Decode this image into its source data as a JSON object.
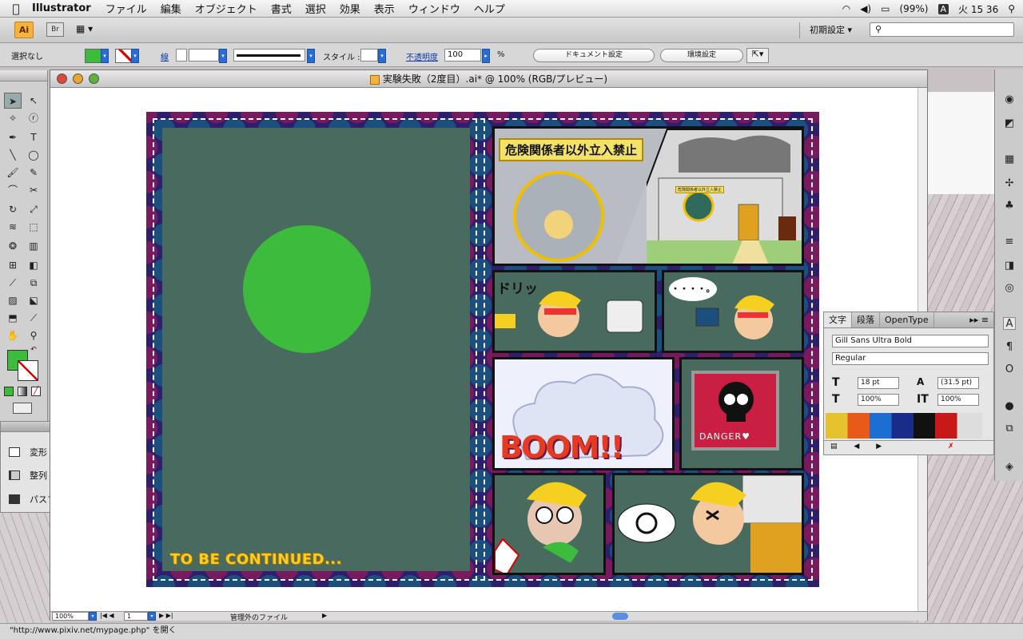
{
  "menubar": {
    "app_name": "Illustrator",
    "items": [
      "ファイル",
      "編集",
      "オブジェクト",
      "書式",
      "選択",
      "効果",
      "表示",
      "ウィンドウ",
      "ヘルプ"
    ],
    "battery": "(99%)",
    "ime": "A",
    "clock": "火 15 36"
  },
  "appbar": {
    "ai_label": "Ai",
    "br_label": "Br",
    "workspace": "初期設定 ▾"
  },
  "controlbar": {
    "selection": "選択なし",
    "stroke_label": "線",
    "style_label": "スタイル :",
    "opacity_label": "不透明度",
    "opacity_value": "100",
    "percent": "%",
    "doc_settings": "ドキュメント設定",
    "env_settings": "環境設定"
  },
  "transform_panel": {
    "items": [
      "変形",
      "整列",
      "パスファインダ"
    ]
  },
  "document": {
    "title": "実験失敗（2度目）.ai* @ 100% (RGB/プレビュー)",
    "zoom": "100%",
    "page": "1",
    "status_text": "管理外のファイル"
  },
  "artwork": {
    "to_be_continued": "TO BE CONTINUED...",
    "sign": "危険関係者以外立入禁止",
    "small_sign": "危険関係者以外立入禁止",
    "sfx_drill": "ドリッ",
    "sfx_boom": "BOOM!!",
    "danger": "DANGER♥",
    "ellipsis": "・・・・。"
  },
  "character_panel": {
    "tabs": [
      "文字",
      "段落",
      "OpenType"
    ],
    "font_family": "Gill Sans Ultra Bold",
    "font_style": "Regular",
    "size": "18 pt",
    "leading": "(31.5 pt)",
    "h_scale": "100%",
    "v_scale": "100%"
  },
  "statusbar": {
    "text": "\"http://www.pixiv.net/mypage.php\" を開く"
  },
  "colors": {
    "accent_green": "#3dbb3d",
    "panel_bg": "#486a5f",
    "border_purple": "#2e1f6e"
  }
}
